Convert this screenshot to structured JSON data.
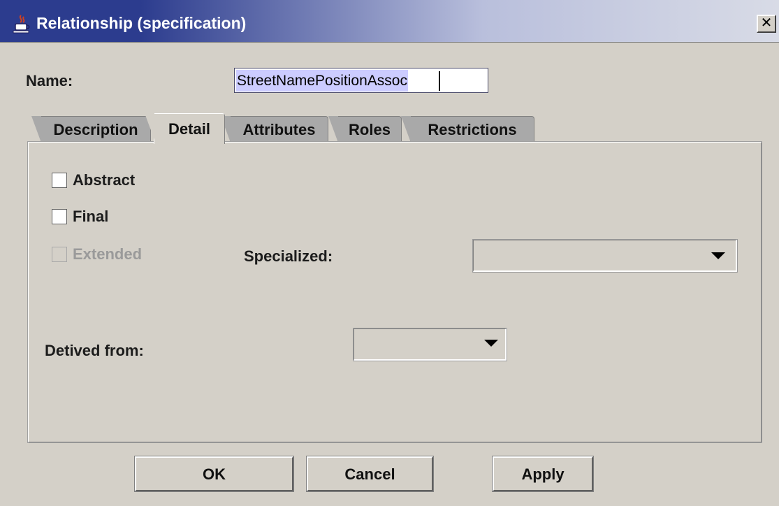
{
  "window": {
    "title": "Relationship (specification)",
    "icon": "java-cup-icon",
    "close_glyph": "✕"
  },
  "name_field": {
    "label": "Name:",
    "value": "StreetNamePositionAssoc"
  },
  "tabs": [
    {
      "label": "Description",
      "active": false
    },
    {
      "label": "Detail",
      "active": true
    },
    {
      "label": "Attributes",
      "active": false
    },
    {
      "label": "Roles",
      "active": false
    },
    {
      "label": "Restrictions",
      "active": false
    }
  ],
  "detail": {
    "abstract": {
      "label": "Abstract",
      "checked": false,
      "enabled": true
    },
    "final": {
      "label": "Final",
      "checked": false,
      "enabled": true
    },
    "extended": {
      "label": "Extended",
      "checked": false,
      "enabled": false
    },
    "specialized": {
      "label": "Specialized:",
      "value": ""
    },
    "derived_from": {
      "label": "Detived from:",
      "value": ""
    }
  },
  "buttons": {
    "ok": "OK",
    "cancel": "Cancel",
    "apply": "Apply"
  },
  "colors": {
    "title_bar_start": "#2c3c8e",
    "window_bg": "#d4d0c8",
    "selection": "#ccccff"
  }
}
